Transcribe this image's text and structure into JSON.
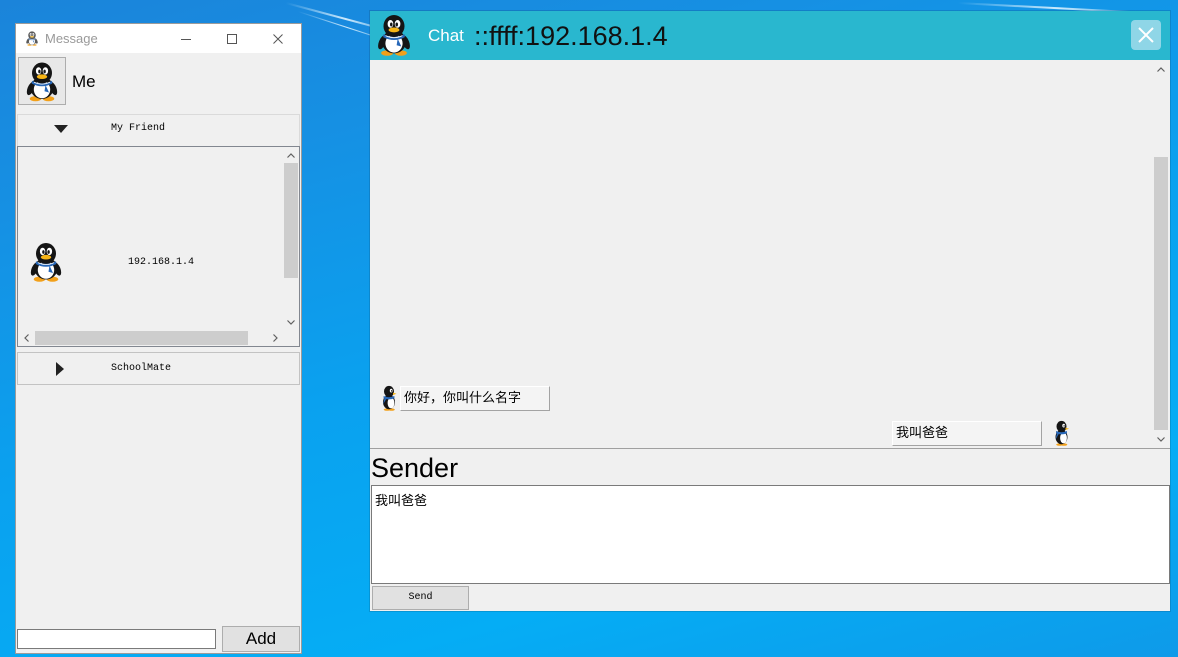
{
  "colors": {
    "desktop_blue": "#0aa1ef",
    "window_background": "#f0f0f0",
    "chat_header": "#29b7cf",
    "chat_close_button": "#8fd6e7",
    "inactive_title_text": "#9a9a9a",
    "scrollbar_thumb": "#cdcdcd"
  },
  "message_window": {
    "title": "Message",
    "title_icon": "penguin-icon",
    "caption_icons": [
      "minimize-icon",
      "maximize-icon",
      "close-icon"
    ],
    "profile": {
      "avatar_icon": "penguin-icon",
      "name": "Me"
    },
    "groups": [
      {
        "label": "My Friend",
        "expanded": true,
        "toggle_icon": "triangle-down-icon",
        "members": [
          {
            "avatar_icon": "penguin-icon",
            "label": "192.168.1.4"
          }
        ]
      },
      {
        "label": "SchoolMate",
        "expanded": false,
        "toggle_icon": "triangle-right-icon",
        "members": []
      }
    ],
    "add_input": {
      "value": "",
      "placeholder": ""
    },
    "add_button_label": "Add"
  },
  "chat_window": {
    "title": "Chat",
    "header_icon": "penguin-icon",
    "peer_address": "::ffff:192.168.1.4",
    "close_icon": "close-icon",
    "messages": [
      {
        "incoming": true,
        "avatar_icon": "penguin-side-icon",
        "text": "你好，你叫什么名字"
      },
      {
        "incoming": false,
        "avatar_icon": "penguin-side-icon",
        "text": "我叫爸爸"
      }
    ],
    "sender_label": "Sender",
    "compose": {
      "value": "我叫爸爸",
      "placeholder": ""
    },
    "send_button_label": "Send"
  }
}
